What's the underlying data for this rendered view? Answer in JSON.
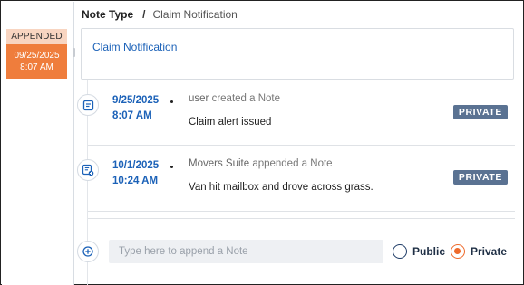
{
  "left_panel": {
    "stamp_label": "APPENDED",
    "stamp_date": "09/25/2025",
    "stamp_time": "8:07 AM"
  },
  "breadcrumb": {
    "part1": "Note Type",
    "separator": "/",
    "part2": "Claim Notification"
  },
  "title_box": {
    "title": "Claim Notification"
  },
  "notes": [
    {
      "date": "9/25/2025",
      "time": "8:07 AM",
      "author": "user",
      "action": "created a Note",
      "body": "Claim alert issued",
      "badge": "PRIVATE",
      "icon": "note-icon"
    },
    {
      "date": "10/1/2025",
      "time": "10:24 AM",
      "author": "Movers Suite",
      "action": "appended a Note",
      "body": "Van hit mailbox and drove across grass.",
      "badge": "PRIVATE",
      "icon": "note-append-icon"
    }
  ],
  "composer": {
    "placeholder": "Type here to append a Note",
    "value": "",
    "visibility_options": [
      {
        "label": "Public",
        "selected": false
      },
      {
        "label": "Private",
        "selected": true
      }
    ]
  },
  "colors": {
    "accent_blue": "#1c62b8",
    "stamp_orange": "#ef7d3c",
    "stamp_light": "#f8d5c1",
    "badge_slate": "#5a7292",
    "radio_selected": "#ee6a2b"
  }
}
